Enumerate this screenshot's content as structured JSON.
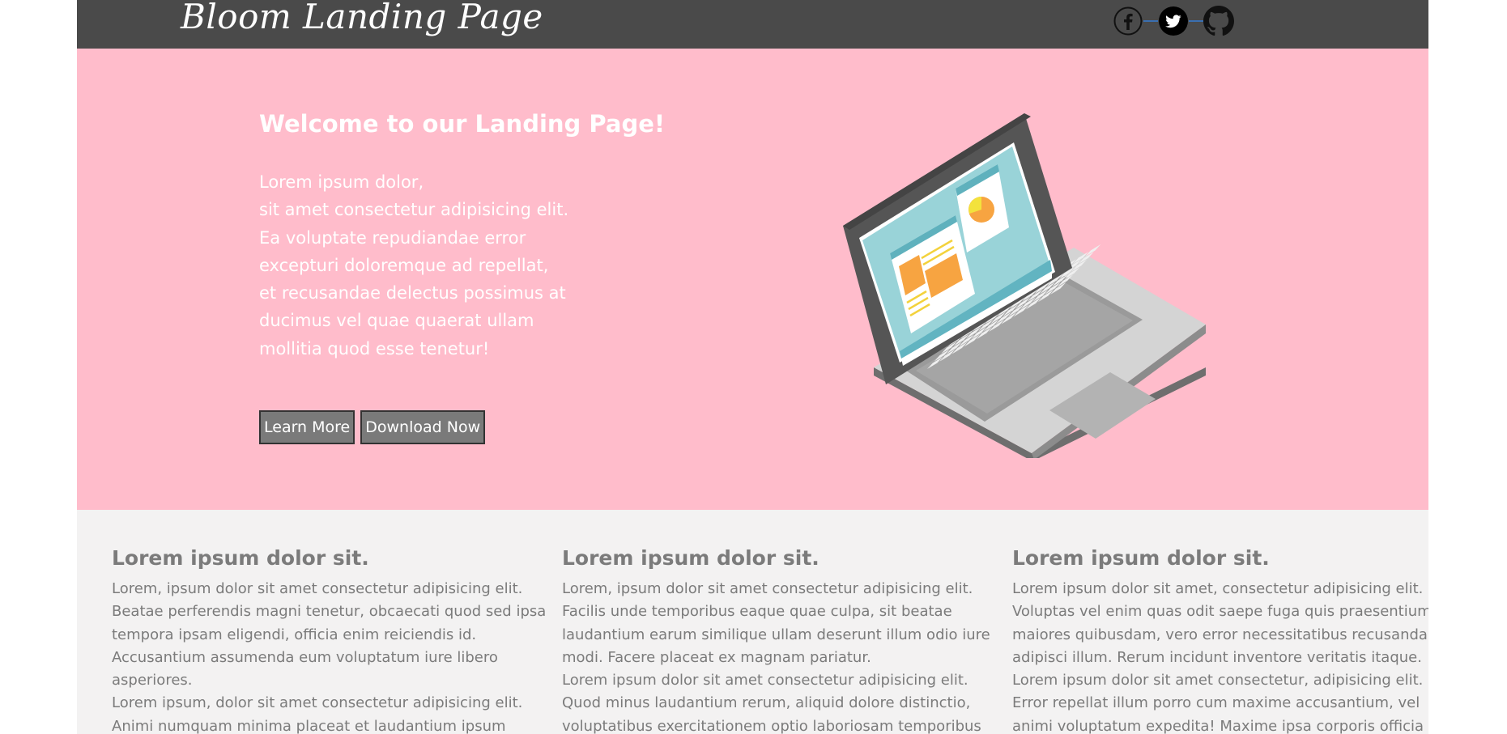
{
  "header": {
    "brand": "Bloom Landing Page",
    "social": [
      {
        "name": "facebook-icon"
      },
      {
        "name": "twitter-icon"
      },
      {
        "name": "github-icon"
      }
    ]
  },
  "hero": {
    "title": "Welcome to our Landing Page!",
    "lines": [
      "Lorem ipsum dolor,",
      "sit amet consectetur adipisicing elit.",
      "Ea voluptate repudiandae error",
      "excepturi doloremque ad repellat,",
      "et recusandae delectus possimus at",
      "ducimus vel quae quaerat ullam",
      "mollitia quod esse tenetur!"
    ],
    "learn_more": "Learn More",
    "download_now": "Download Now",
    "illustration": "laptop-illustration"
  },
  "features": [
    {
      "title": "Lorem ipsum dolor sit.",
      "lines": [
        "Lorem, ipsum dolor sit amet consectetur adipisicing elit.",
        "Beatae perferendis magni tenetur, obcaecati quod sed ipsa",
        "tempora ipsam eligendi, officia enim reiciendis id.",
        "Accusantium assumenda eum voluptatum iure libero",
        "asperiores.",
        "Lorem ipsum, dolor sit amet consectetur adipisicing elit.",
        "Animi numquam minima placeat et laudantium ipsum"
      ]
    },
    {
      "title": "Lorem ipsum dolor sit.",
      "lines": [
        "Lorem, ipsum dolor sit amet consectetur adipisicing elit.",
        "Facilis unde temporibus eaque quae culpa, sit beatae",
        "laudantium earum similique ullam deserunt illum odio iure",
        "modi. Facere placeat ex magnam pariatur.",
        "Lorem ipsum dolor sit amet consectetur adipisicing elit.",
        "Quod minus laudantium rerum, aliquid dolore distinctio,",
        "voluptatibus exercitationem optio laboriosam temporibus"
      ]
    },
    {
      "title": "Lorem ipsum dolor sit.",
      "lines": [
        "Lorem ipsum dolor sit amet, consectetur adipisicing elit.",
        "Voluptas vel enim quas odit saepe fuga quis praesentium",
        "maiores quibusdam, vero error necessitatibus recusandae",
        "adipisci illum. Rerum incidunt inventore veritatis itaque.",
        "Lorem ipsum dolor sit amet consectetur, adipisicing elit.",
        "Error repellat illum porro cum maxime accusantium, vel",
        "animi voluptatum expedita! Maxime ipsa corporis officia"
      ]
    }
  ],
  "colors": {
    "header_bg": "#4a4a4a",
    "hero_bg": "#ffbccb",
    "features_bg": "#f3f2f2",
    "text_gray": "#7b7b7b",
    "button_bg": "#7a7a7a"
  }
}
